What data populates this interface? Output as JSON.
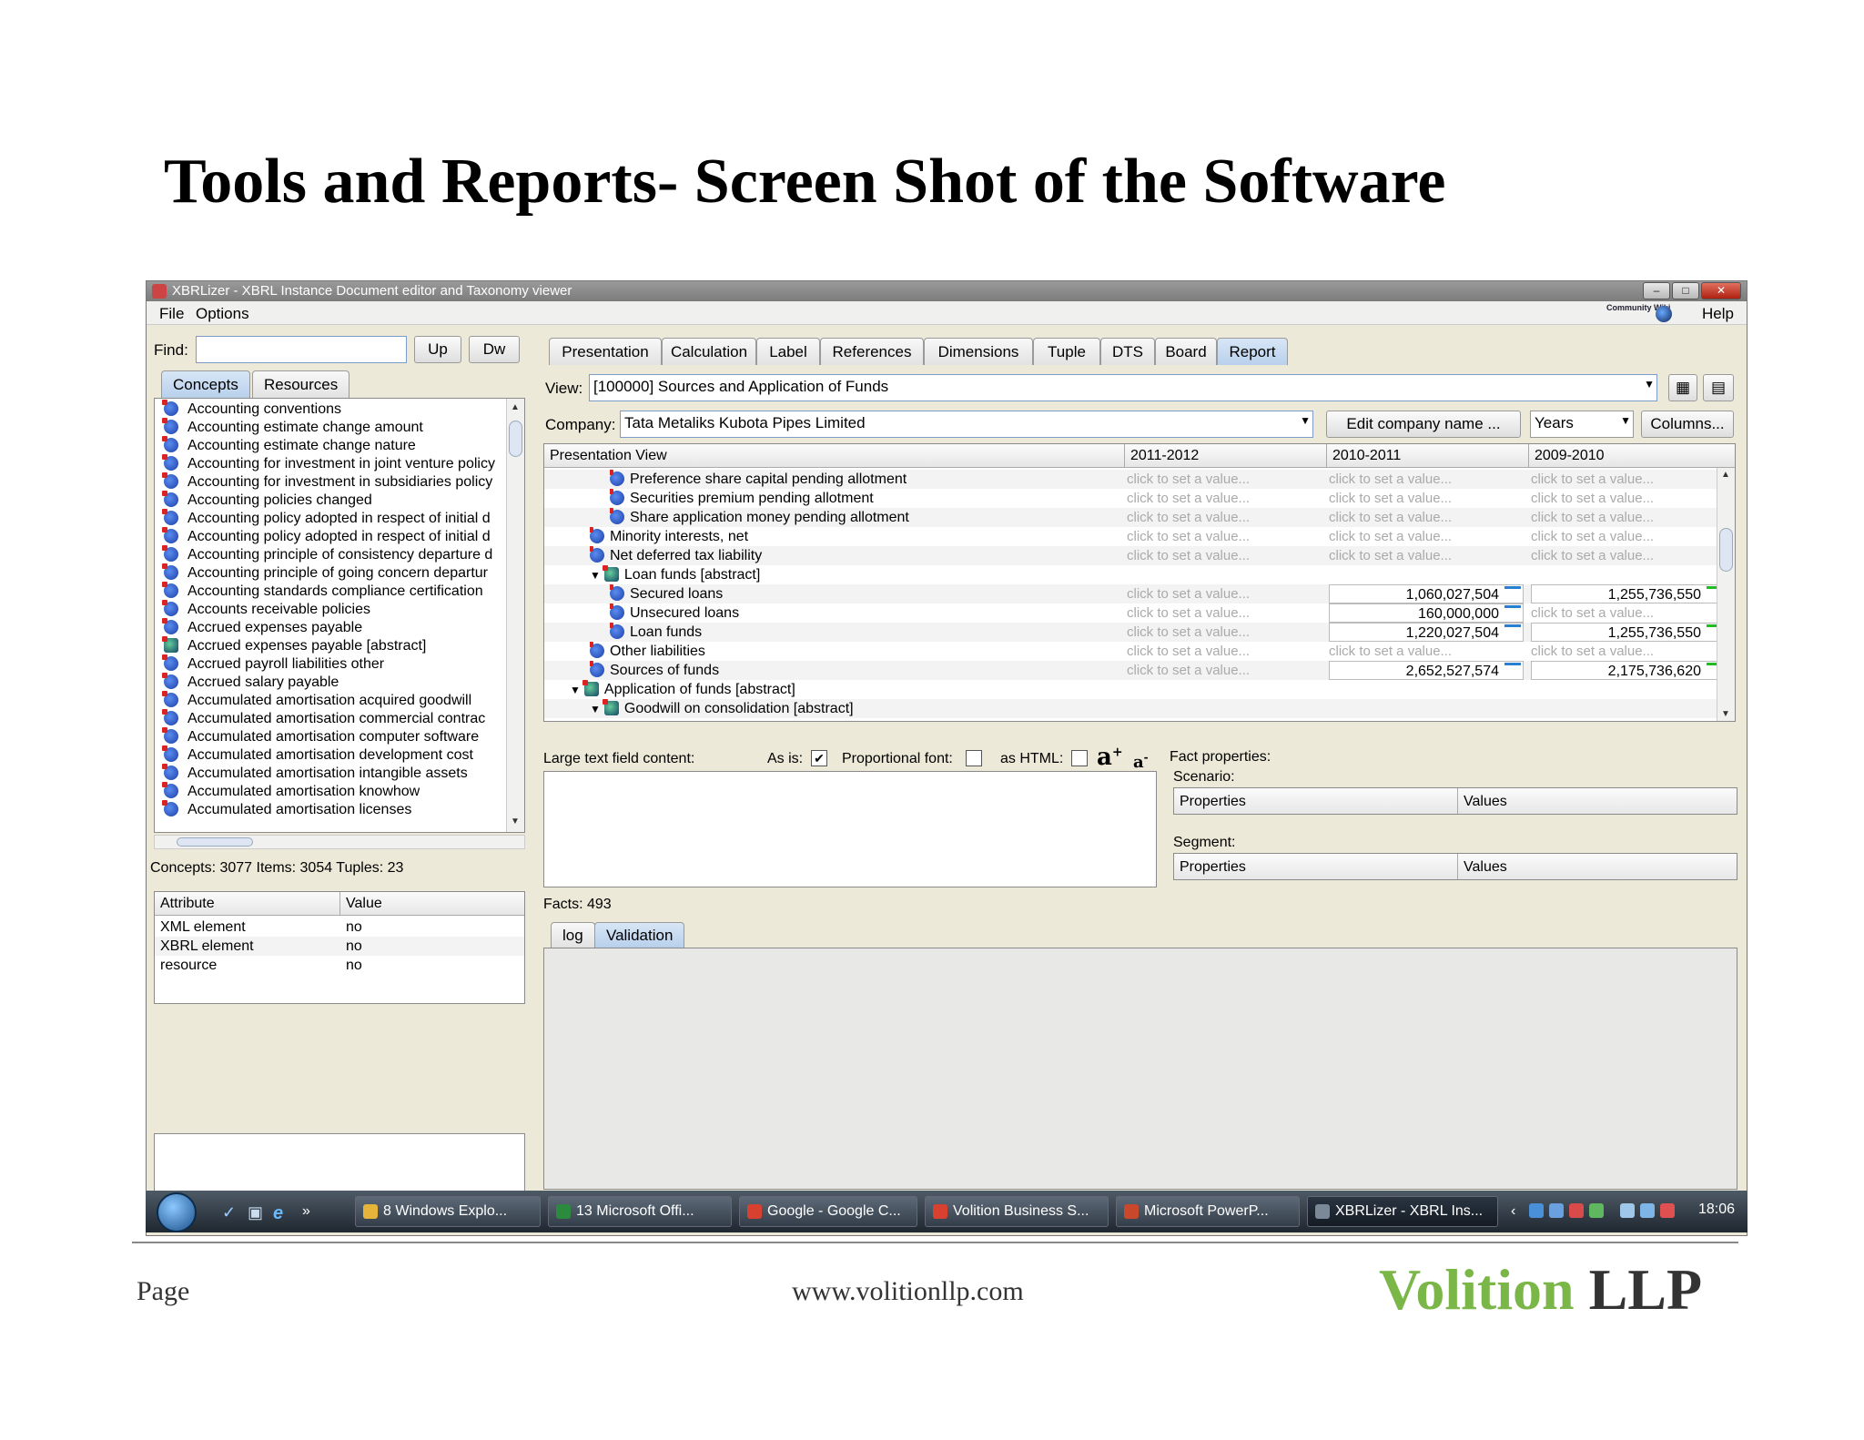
{
  "slide": {
    "title": "Tools and Reports- Screen Shot of the Software",
    "footer_page": "Page",
    "footer_url": "www.volitionllp.com",
    "brand_first": "Volition",
    "brand_second": "LLP",
    "brand_first_color": "#7ab648",
    "brand_second_color": "#333333"
  },
  "window": {
    "title": "XBRLizer - XBRL Instance Document editor and Taxonomy viewer",
    "menu": [
      "File",
      "Options"
    ],
    "wiki_label": "Community Wiki",
    "help": "Help"
  },
  "left": {
    "find_label": "Find:",
    "find_value": "",
    "up": "Up",
    "dw": "Dw",
    "tabs": [
      "Concepts",
      "Resources"
    ],
    "concepts": [
      {
        "label": "Accounting conventions",
        "abstract": false
      },
      {
        "label": "Accounting estimate change amount",
        "abstract": false
      },
      {
        "label": "Accounting estimate change nature",
        "abstract": false
      },
      {
        "label": "Accounting for investment in joint venture policy",
        "abstract": false
      },
      {
        "label": "Accounting for investment in subsidiaries policy",
        "abstract": false
      },
      {
        "label": "Accounting policies changed",
        "abstract": false
      },
      {
        "label": "Accounting policy adopted in respect of initial d",
        "abstract": false
      },
      {
        "label": "Accounting policy adopted in respect of initial d",
        "abstract": false
      },
      {
        "label": "Accounting principle of consistency departure d",
        "abstract": false
      },
      {
        "label": "Accounting principle of going concern departur",
        "abstract": false
      },
      {
        "label": "Accounting standards compliance certification",
        "abstract": false
      },
      {
        "label": "Accounts receivable policies",
        "abstract": false
      },
      {
        "label": "Accrued expenses payable",
        "abstract": false
      },
      {
        "label": "Accrued expenses payable [abstract]",
        "abstract": true
      },
      {
        "label": "Accrued payroll liabilities other",
        "abstract": false
      },
      {
        "label": "Accrued salary payable",
        "abstract": false
      },
      {
        "label": "Accumulated amortisation acquired goodwill",
        "abstract": false
      },
      {
        "label": "Accumulated amortisation commercial contrac",
        "abstract": false
      },
      {
        "label": "Accumulated amortisation computer software",
        "abstract": false
      },
      {
        "label": "Accumulated amortisation development cost",
        "abstract": false
      },
      {
        "label": "Accumulated amortisation intangible assets",
        "abstract": false
      },
      {
        "label": "Accumulated amortisation knowhow",
        "abstract": false
      },
      {
        "label": "Accumulated amortisation licenses",
        "abstract": false
      }
    ],
    "status": "Concepts: 3077 Items: 3054 Tuples: 23",
    "attr_headers": [
      "Attribute",
      "Value"
    ],
    "attributes": [
      {
        "name": "XML element",
        "value": "no"
      },
      {
        "name": "XBRL element",
        "value": "no"
      },
      {
        "name": "resource",
        "value": "no"
      }
    ]
  },
  "right": {
    "tabs": [
      "Presentation",
      "Calculation",
      "Label",
      "References",
      "Dimensions",
      "Tuple",
      "DTS",
      "Board",
      "Report"
    ],
    "active_tab": "Report",
    "view_label": "View:",
    "view_value": "[100000] Sources and Application of Funds",
    "company_label": "Company:",
    "company_value": "Tata Metaliks Kubota Pipes Limited",
    "edit_company": "Edit company name ...",
    "period_value": "Years",
    "columns_btn": "Columns...",
    "grid_headers": [
      "Presentation View",
      "2011-2012",
      "2010-2011",
      "2009-2010"
    ],
    "placeholder": "click to set a value...",
    "rows": [
      {
        "label": "Preference share capital pending allotment",
        "indent": 3,
        "expand": "",
        "abstract": false,
        "values": [
          "",
          "",
          ""
        ]
      },
      {
        "label": "Securities premium pending allotment",
        "indent": 3,
        "expand": "",
        "abstract": false,
        "values": [
          "",
          "",
          ""
        ]
      },
      {
        "label": "Share application money pending allotment",
        "indent": 3,
        "expand": "",
        "abstract": false,
        "values": [
          "",
          "",
          ""
        ]
      },
      {
        "label": "Minority interests, net",
        "indent": 2,
        "expand": "",
        "abstract": false,
        "values": [
          "",
          "",
          ""
        ]
      },
      {
        "label": "Net deferred tax liability",
        "indent": 2,
        "expand": "",
        "abstract": false,
        "values": [
          "",
          "",
          ""
        ]
      },
      {
        "label": "Loan funds [abstract]",
        "indent": 2,
        "expand": "▼",
        "abstract": true,
        "values": null
      },
      {
        "label": "Secured loans",
        "indent": 3,
        "expand": "",
        "abstract": false,
        "values": [
          "",
          "1,060,027,504",
          "1,255,736,550"
        ]
      },
      {
        "label": "Unsecured loans",
        "indent": 3,
        "expand": "",
        "abstract": false,
        "values": [
          "",
          "160,000,000",
          ""
        ]
      },
      {
        "label": "Loan funds",
        "indent": 3,
        "expand": "",
        "abstract": false,
        "values": [
          "",
          "1,220,027,504",
          "1,255,736,550"
        ]
      },
      {
        "label": "Other liabilities",
        "indent": 2,
        "expand": "",
        "abstract": false,
        "values": [
          "",
          "",
          ""
        ]
      },
      {
        "label": "Sources of funds",
        "indent": 2,
        "expand": "",
        "abstract": false,
        "values": [
          "",
          "2,652,527,574",
          "2,175,736,620"
        ]
      },
      {
        "label": "Application of funds [abstract]",
        "indent": 1,
        "expand": "▼",
        "abstract": true,
        "values": null
      },
      {
        "label": "Goodwill on consolidation [abstract]",
        "indent": 2,
        "expand": "▼",
        "abstract": true,
        "values": null
      }
    ],
    "large_text_label": "Large text field content:",
    "as_is_label": "As is:",
    "proportional_label": "Proportional font:",
    "as_html_label": "as HTML:",
    "fact_props": "Fact properties:",
    "scenario": "Scenario:",
    "segment": "Segment:",
    "props_headers": [
      "Properties",
      "Values"
    ],
    "facts": "Facts: 493",
    "log_tabs": [
      "log",
      "Validation"
    ]
  },
  "taskbar": {
    "items": [
      {
        "label": "8 Windows Explo...",
        "color": "#e6b43a"
      },
      {
        "label": "13 Microsoft Offi...",
        "color": "#2c8a3e"
      },
      {
        "label": "Google - Google C...",
        "color": "#d8412f"
      },
      {
        "label": "Volition Business S...",
        "color": "#d8412f"
      },
      {
        "label": "Microsoft PowerP...",
        "color": "#c9482b"
      },
      {
        "label": "XBRLizer - XBRL Ins...",
        "color": "#7a8898"
      }
    ],
    "clock": "18:06"
  }
}
